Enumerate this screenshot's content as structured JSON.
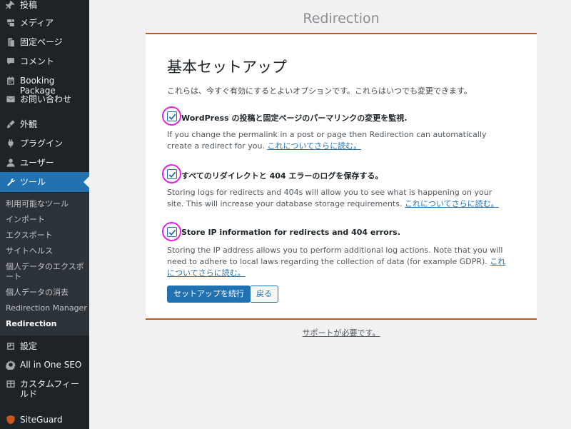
{
  "sidebar": {
    "menu": [
      {
        "label": "投稿",
        "icon": "pushpin-icon"
      },
      {
        "label": "メディア",
        "icon": "media-icon"
      },
      {
        "label": "固定ページ",
        "icon": "page-icon"
      },
      {
        "label": "コメント",
        "icon": "comment-icon"
      },
      {
        "label": "Booking Package",
        "icon": "calendar-icon"
      },
      {
        "label": "お問い合わせ",
        "icon": "mail-icon"
      },
      {
        "label": "外観",
        "icon": "brush-icon"
      },
      {
        "label": "プラグイン",
        "icon": "plugin-icon"
      },
      {
        "label": "ユーザー",
        "icon": "user-icon"
      },
      {
        "label": "ツール",
        "icon": "wrench-icon"
      },
      {
        "label": "設定",
        "icon": "settings-icon"
      },
      {
        "label": "All in One SEO",
        "icon": "seo-icon"
      },
      {
        "label": "カスタムフィールド",
        "icon": "table-icon"
      },
      {
        "label": "SiteGuard",
        "icon": "shield-icon"
      }
    ],
    "submenu": [
      "利用可能なツール",
      "インポート",
      "エクスポート",
      "サイトヘルス",
      "個人データのエクスポート",
      "個人データの消去",
      "Redirection Manager",
      "Redirection"
    ]
  },
  "header": {
    "title": "Redirection"
  },
  "panel": {
    "title": "基本セットアップ",
    "description": "これらは、今すぐ有効にするとよいオプションです。これらはいつでも変更できます。",
    "options": [
      {
        "label": "WordPress の投稿と固定ページのパーマリンクの変更を監視.",
        "desc": "If you change the permalink in a post or page then Redirection can automatically create a redirect for you.",
        "link": "これについてさらに読む。",
        "checked": true
      },
      {
        "label": "すべてのリダイレクトと 404 エラーのログを保存する。",
        "desc": "Storing logs for redirects and 404s will allow you to see what is happening on your site. This will increase your database storage requirements.",
        "link": "これについてさらに読む。",
        "checked": true
      },
      {
        "label": "Store IP information for redirects and 404 errors.",
        "desc": "Storing the IP address allows you to perform additional log actions. Note that you will need to adhere to local laws regarding the collection of data (for example GDPR).",
        "link": "これについてさらに読む。",
        "checked": true
      }
    ],
    "continue_label": "セットアップを続行",
    "back_label": "戻る"
  },
  "support_link": "サポートが必要です。",
  "colors": {
    "accent": "#2271b1",
    "sidebar": "#1d2327",
    "panel_border": "#c9581f",
    "highlight_ring": "#e61ee6"
  }
}
